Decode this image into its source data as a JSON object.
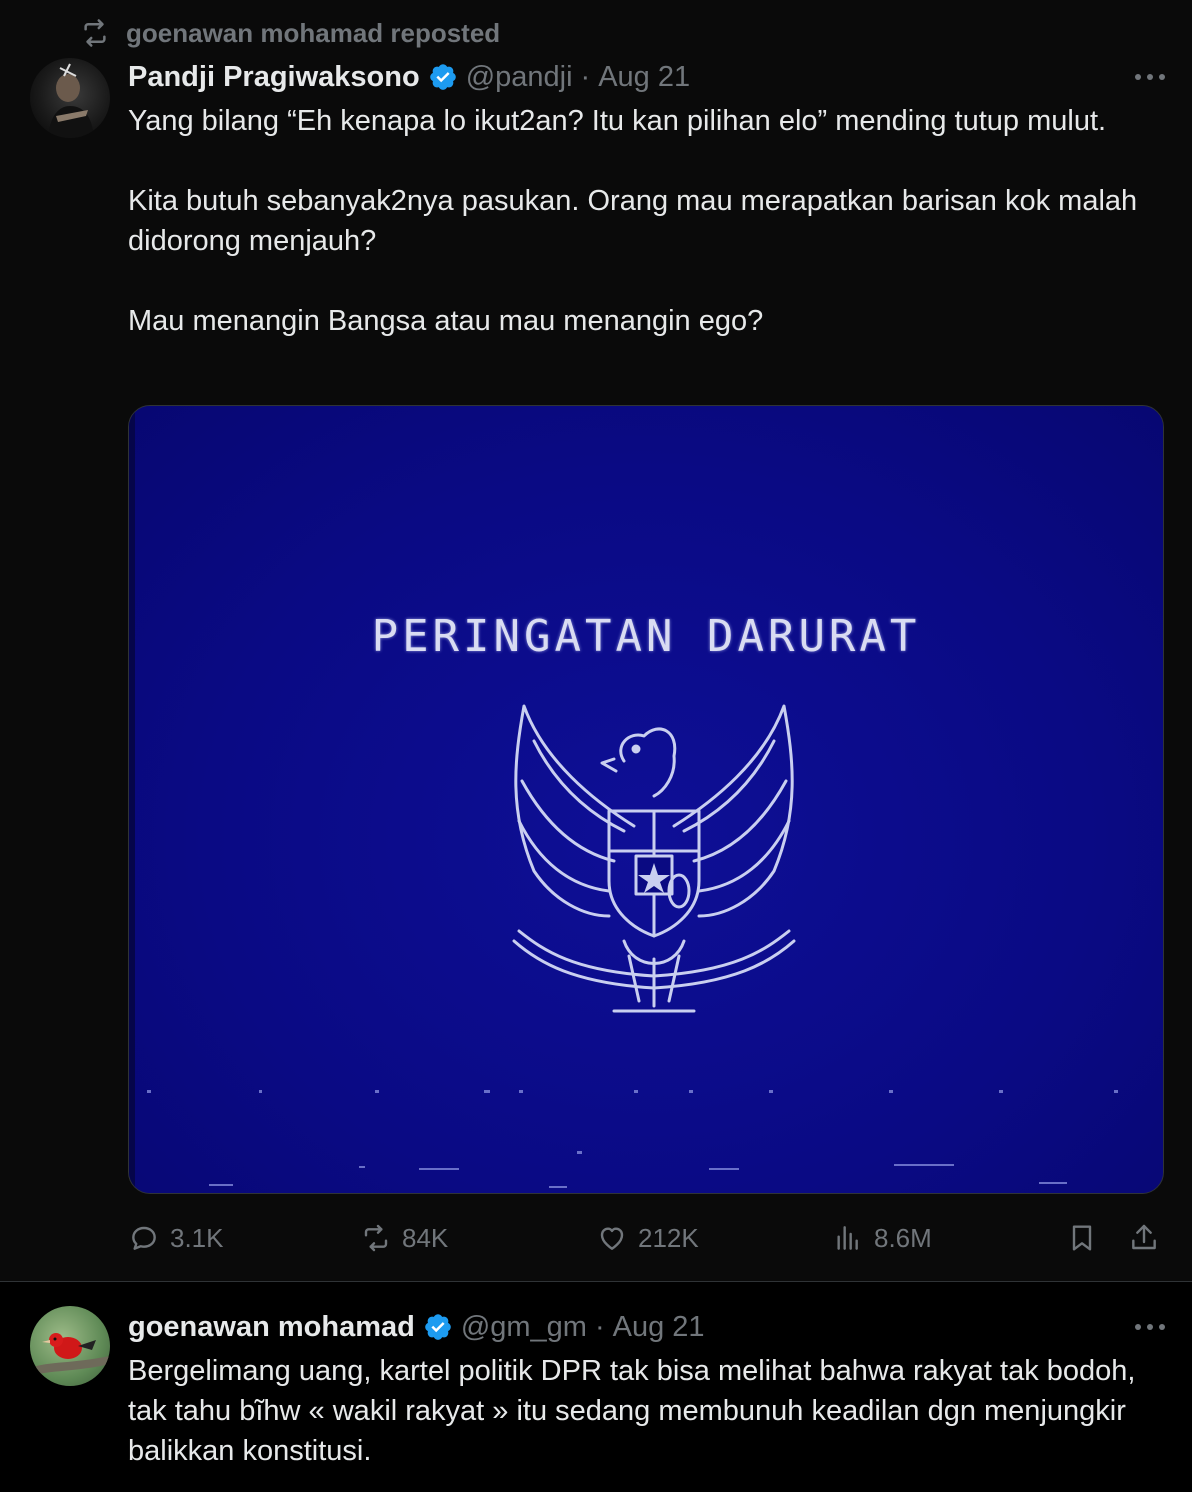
{
  "repost": {
    "label": "goenawan mohamad reposted",
    "icon": "repost-icon"
  },
  "post1": {
    "name": "Pandji Pragiwaksono",
    "handle": "@pandji",
    "separator": "·",
    "date": "Aug 21",
    "text_lines": [
      "Yang bilang “Eh kenapa lo ikut2an? Itu kan pilihan elo” mending tutup mulut.",
      "Kita butuh sebanyak2nya pasukan. Orang mau merapatkan barisan kok malah didorong menjauh?",
      "Mau menangin Bangsa atau mau menangin ego?"
    ],
    "media_text": "PERINGATAN DARURAT",
    "stats": {
      "replies": "3.1K",
      "reposts": "84K",
      "likes": "212K",
      "views": "8.6M"
    }
  },
  "post2": {
    "name": "goenawan mohamad",
    "handle": "@gm_gm",
    "separator": "·",
    "date": "Aug 21",
    "text": "Bergelimang uang, kartel politik DPR tak bisa melihat bahwa rakyat  tak bodoh, tak tahu bĩhw « wakil rakyat » itu sedang membunuh keadilan dgn menjungkir balikkan konstitusi."
  },
  "colors": {
    "background": "#0a0a0a",
    "text": "#e7e9ea",
    "muted": "#71767b",
    "verified": "#1d9bf0",
    "media_blue": "#0a0a82"
  }
}
